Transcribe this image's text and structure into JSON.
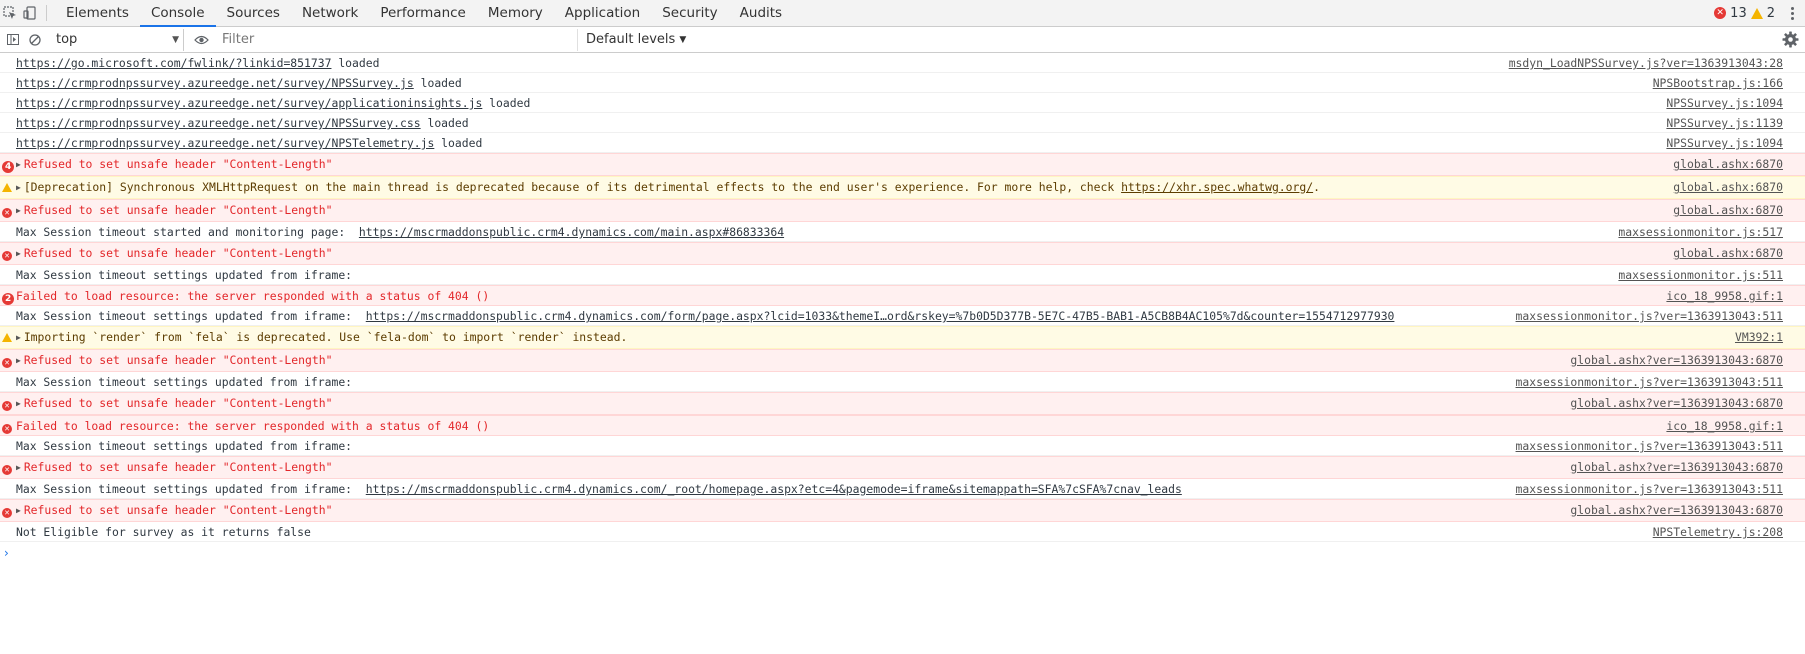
{
  "tabs": [
    "Elements",
    "Console",
    "Sources",
    "Network",
    "Performance",
    "Memory",
    "Application",
    "Security",
    "Audits"
  ],
  "active_tab": "Console",
  "counts": {
    "errors": "13",
    "warnings": "2"
  },
  "toolbar": {
    "context": "top",
    "filter_placeholder": "Filter",
    "levels": "Default levels"
  },
  "colors": {
    "accent": "#1a73e8",
    "error": "#e53935",
    "warning": "#f4b400"
  },
  "messages": [
    {
      "type": "log",
      "text": "",
      "link": "https://go.microsoft.com/fwlink/?linkid=851737",
      "suffix": " loaded",
      "source": "msdyn_LoadNPSSurvey.js?ver=1363913043:28"
    },
    {
      "type": "log",
      "text": "",
      "link": "https://crmprodnpssurvey.azureedge.net/survey/NPSSurvey.js",
      "suffix": " loaded",
      "source": "NPSBootstrap.js:166"
    },
    {
      "type": "log",
      "text": "",
      "link": "https://crmprodnpssurvey.azureedge.net/survey/applicationinsights.js",
      "suffix": " loaded",
      "source": "NPSSurvey.js:1094"
    },
    {
      "type": "log",
      "text": "",
      "link": "https://crmprodnpssurvey.azureedge.net/survey/NPSSurvey.css",
      "suffix": " loaded",
      "source": "NPSSurvey.js:1139"
    },
    {
      "type": "log",
      "text": "",
      "link": "https://crmprodnpssurvey.azureedge.net/survey/NPSTelemetry.js",
      "suffix": " loaded",
      "source": "NPSSurvey.js:1094"
    },
    {
      "type": "error",
      "badge": "4",
      "expandable": true,
      "text": "Refused to set unsafe header \"Content-Length\"",
      "source": "global.ashx:6870"
    },
    {
      "type": "warning",
      "expandable": true,
      "text": "[Deprecation] Synchronous XMLHttpRequest on the main thread is deprecated because of its detrimental effects to the end user's experience. For more help, check ",
      "link": "https://xhr.spec.whatwg.org/",
      "suffix": ".",
      "source": "global.ashx:6870"
    },
    {
      "type": "error",
      "expandable": true,
      "text": "Refused to set unsafe header \"Content-Length\"",
      "source": "global.ashx:6870"
    },
    {
      "type": "log",
      "text": "Max Session timeout started and monitoring page:  ",
      "link": "https://mscrmaddonspublic.crm4.dynamics.com/main.aspx#86833364",
      "suffix": "",
      "source": "maxsessionmonitor.js:517"
    },
    {
      "type": "error",
      "expandable": true,
      "text": "Refused to set unsafe header \"Content-Length\"",
      "source": "global.ashx:6870"
    },
    {
      "type": "log",
      "text": "Max Session timeout settings updated from iframe: ",
      "source": "maxsessionmonitor.js:511"
    },
    {
      "type": "error",
      "badge": "2",
      "text": "Failed to load resource: the server responded with a status of 404 ()",
      "source": "ico_18_9958.gif:1"
    },
    {
      "type": "log",
      "text": "Max Session timeout settings updated from iframe:  ",
      "link": "https://mscrmaddonspublic.crm4.dynamics.com/form/page.aspx?lcid=1033&themeI…ord&rskey=%7b0D5D377B-5E7C-47B5-BAB1-A5CB8B4AC105%7d&counter=1554712977930",
      "suffix": "",
      "source": "maxsessionmonitor.js?ver=1363913043:511"
    },
    {
      "type": "warning",
      "expandable": true,
      "text": "Importing `render` from `fela` is deprecated. Use `fela-dom` to import `render` instead.",
      "source": "VM392:1"
    },
    {
      "type": "error",
      "expandable": true,
      "text": "Refused to set unsafe header \"Content-Length\"",
      "source": "global.ashx?ver=1363913043:6870"
    },
    {
      "type": "log",
      "text": "Max Session timeout settings updated from iframe: ",
      "source": "maxsessionmonitor.js?ver=1363913043:511"
    },
    {
      "type": "error",
      "expandable": true,
      "text": "Refused to set unsafe header \"Content-Length\"",
      "source": "global.ashx?ver=1363913043:6870"
    },
    {
      "type": "error",
      "text": "Failed to load resource: the server responded with a status of 404 ()",
      "source": "ico_18_9958.gif:1"
    },
    {
      "type": "log",
      "text": "Max Session timeout settings updated from iframe: ",
      "source": "maxsessionmonitor.js?ver=1363913043:511"
    },
    {
      "type": "error",
      "expandable": true,
      "text": "Refused to set unsafe header \"Content-Length\"",
      "source": "global.ashx?ver=1363913043:6870"
    },
    {
      "type": "log",
      "text": "Max Session timeout settings updated from iframe:  ",
      "link": "https://mscrmaddonspublic.crm4.dynamics.com/_root/homepage.aspx?etc=4&pagemode=iframe&sitemappath=SFA%7cSFA%7cnav_leads",
      "suffix": "",
      "source": "maxsessionmonitor.js?ver=1363913043:511"
    },
    {
      "type": "error",
      "expandable": true,
      "text": "Refused to set unsafe header \"Content-Length\"",
      "source": "global.ashx?ver=1363913043:6870"
    },
    {
      "type": "log",
      "text": "Not Eligible for survey as it returns false",
      "source": "NPSTelemetry.js:208"
    }
  ]
}
